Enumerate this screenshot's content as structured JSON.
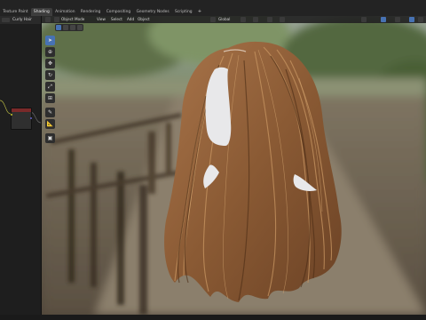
{
  "app": {
    "workspace_tabs": [
      "Texture Paint",
      "Shading",
      "Animation",
      "Rendering",
      "Compositing",
      "Geometry Nodes",
      "Scripting"
    ],
    "active_tab": "Shading",
    "add_tab_label": "+"
  },
  "left_panel": {
    "title": "Curly Hair",
    "node_rows": [
      "",
      "",
      "",
      "",
      ""
    ]
  },
  "viewport_header": {
    "mode": "Object Mode",
    "menus": [
      "View",
      "Select",
      "Add",
      "Object"
    ],
    "transform": "Global"
  },
  "tools": [
    {
      "name": "select-tool",
      "glyph": "➤"
    },
    {
      "name": "cursor-tool",
      "glyph": "⊕"
    },
    {
      "name": "move-tool",
      "glyph": "✥"
    },
    {
      "name": "rotate-tool",
      "glyph": "↻"
    },
    {
      "name": "scale-tool",
      "glyph": "⤢"
    },
    {
      "name": "transform-tool",
      "glyph": "⊞"
    },
    {
      "name": "annotate-tool",
      "glyph": "✎"
    },
    {
      "name": "measure-tool",
      "glyph": "📐"
    },
    {
      "name": "add-cube-tool",
      "glyph": "▣"
    }
  ],
  "colors": {
    "accent": "#4772b3",
    "header_bg": "#232323",
    "panel_bg": "#1e1e1e",
    "hair_base": "#8a5a34",
    "hair_light": "#c89662",
    "hair_dark": "#4b2c15",
    "scalp_mask": "#e8e8ea"
  }
}
